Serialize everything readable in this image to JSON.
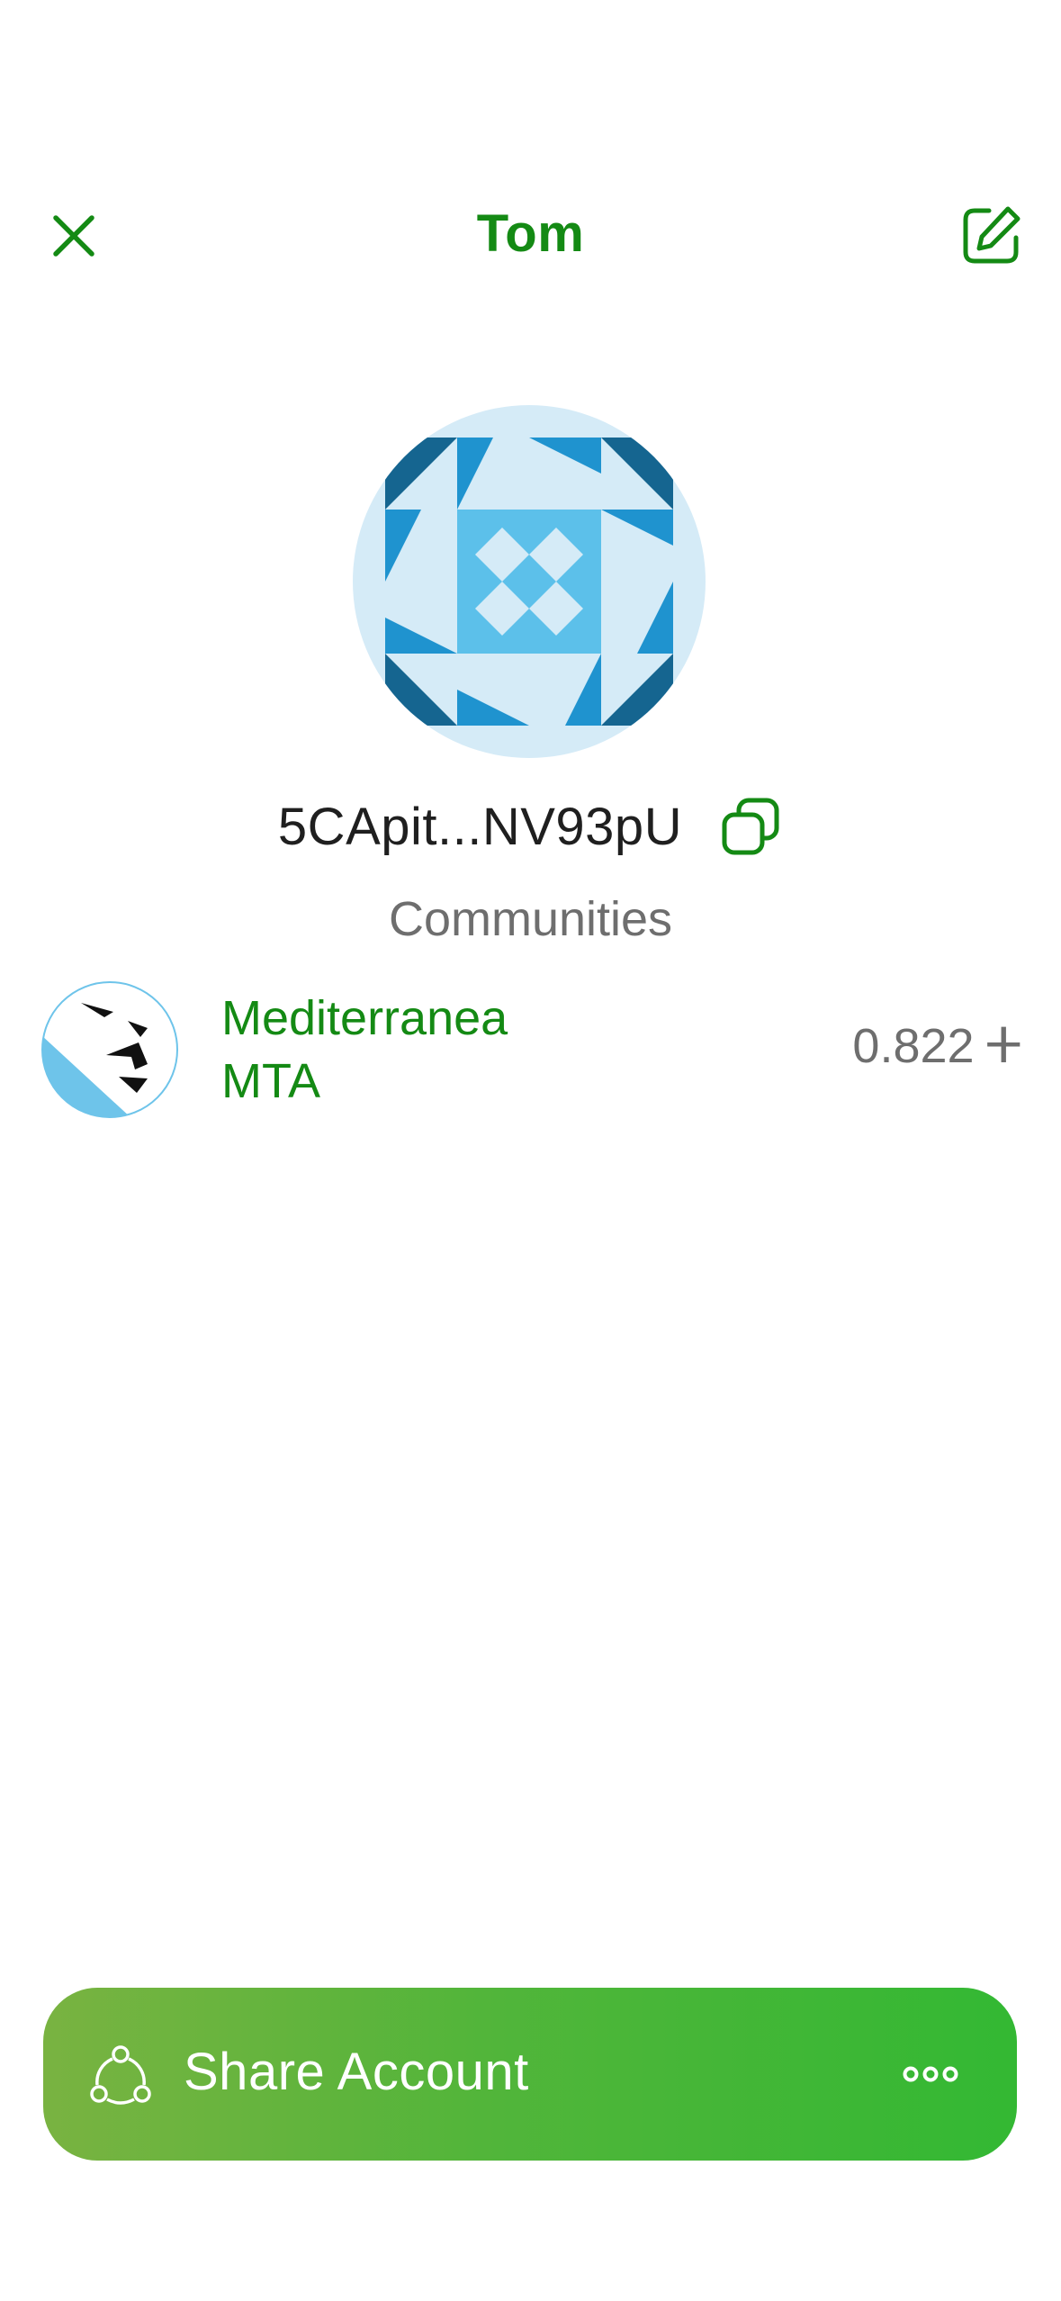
{
  "header": {
    "title": "Tom",
    "close_icon": "close-icon",
    "edit_icon": "edit-icon"
  },
  "account": {
    "address_short": "5CApit...NV93pU",
    "copy_icon": "copy-icon"
  },
  "communities": {
    "section_title": "Communities",
    "items": [
      {
        "name": "Mediterranea MTA",
        "balance": "0.822",
        "currency_symbol": "ⵜ"
      }
    ]
  },
  "actions": {
    "share_label": "Share Account",
    "share_icon": "share-icon",
    "more_icon": "more-icon"
  },
  "colors": {
    "accent": "#148a14",
    "button_start": "#79b341",
    "button_end": "#33b833",
    "muted_text": "#6e6e6e",
    "identicon_bg": "#d5ebf7",
    "identicon_dark": "#156590",
    "identicon_mid": "#1f93cf",
    "identicon_light": "#5cc0ea"
  }
}
